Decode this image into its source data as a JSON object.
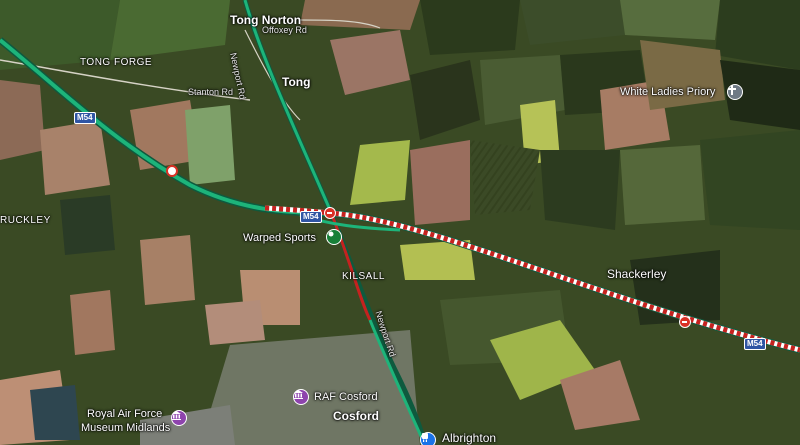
{
  "places": {
    "tong_norton": "Tong Norton",
    "tong": "Tong",
    "tong_forge": "TONG FORGE",
    "ruckley": "RUCKLEY",
    "kilsall": "KILSALL",
    "shackerley": "Shackerley",
    "cosford": "Cosford",
    "albrighton": "Albrighton"
  },
  "roads": {
    "ottoxey": "Offoxey Rd",
    "newport_top": "Newport Rd",
    "stanton": "Stanton Rd",
    "newport_bottom": "Newport Rd",
    "m54_shield": "M54"
  },
  "pois": {
    "white_ladies": "White Ladies Priory",
    "warped_sports": "Warped Sports",
    "raf_cosford": "RAF Cosford",
    "raf_museum_line1": "Royal Air Force",
    "raf_museum_line2": "Museum Midlands"
  },
  "colors": {
    "traffic_free": "#1db47a",
    "traffic_jam": "#c5221f",
    "motorway_shield": "#2f55a4",
    "poi_landmark": "#6f7a85",
    "poi_museum": "#8e44ad",
    "poi_leisure": "#188038",
    "poi_transit": "#1a73e8"
  },
  "icons": {
    "white_ladies": "cross-icon",
    "warped_sports": "leisure-icon",
    "raf_cosford": "museum-icon",
    "raf_museum": "museum-icon",
    "albrighton": "train-icon"
  }
}
